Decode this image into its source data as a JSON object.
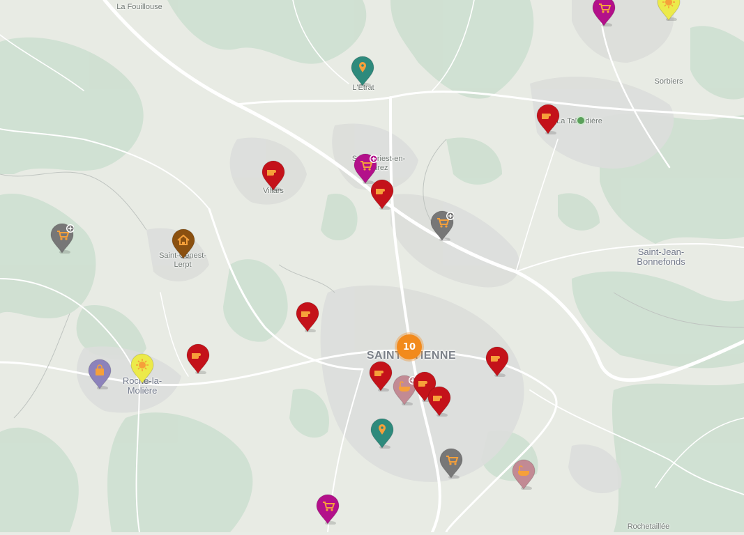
{
  "map": {
    "places": [
      {
        "id": "la-fouillouse",
        "label": "La Fouillouse"
      },
      {
        "id": "l-etrat",
        "label": "L'Etrat"
      },
      {
        "id": "sorbiers",
        "label": "Sorbiers"
      },
      {
        "id": "la-talaudiere",
        "label": "La Talaudière"
      },
      {
        "id": "saint-priest",
        "label": "Saint-Priest-en-Jarez"
      },
      {
        "id": "villars",
        "label": "Villars"
      },
      {
        "id": "saint-genest",
        "label": "Saint-Genest-Lerpt"
      },
      {
        "id": "saint-jean",
        "label": "Saint-Jean-Bonnefonds"
      },
      {
        "id": "saint-etienne",
        "label": "SAINT-ETIENNE"
      },
      {
        "id": "roche-la-moliere",
        "label": "Roche-la-Molière"
      },
      {
        "id": "rochetaillee",
        "label": "Rochetaillée"
      }
    ],
    "cluster": {
      "count": "10"
    },
    "markers": [
      {
        "type": "shop",
        "color": "#b3108a"
      },
      {
        "type": "sun",
        "color": "#ecea4a"
      },
      {
        "type": "pin",
        "color": "#2e8a7c"
      },
      {
        "type": "hand",
        "color": "#c4121a"
      },
      {
        "type": "shop-plus",
        "color": "#b3108a"
      },
      {
        "type": "hand",
        "color": "#c4121a"
      },
      {
        "type": "hand",
        "color": "#c4121a"
      },
      {
        "type": "shop-plus",
        "color": "#777777"
      },
      {
        "type": "shop-plus",
        "color": "#777777"
      },
      {
        "type": "home",
        "color": "#8a5010"
      },
      {
        "type": "hand",
        "color": "#c4121a"
      },
      {
        "type": "hand",
        "color": "#c4121a"
      },
      {
        "type": "bag",
        "color": "#8c82bb"
      },
      {
        "type": "sun",
        "color": "#ecea4a"
      },
      {
        "type": "hand",
        "color": "#c4121a"
      },
      {
        "type": "hand",
        "color": "#c4121a"
      },
      {
        "type": "bath-plus",
        "color": "#c28a94"
      },
      {
        "type": "hand",
        "color": "#c4121a"
      },
      {
        "type": "hand",
        "color": "#c4121a"
      },
      {
        "type": "pin",
        "color": "#2e8a7c"
      },
      {
        "type": "shop",
        "color": "#777777"
      },
      {
        "type": "bath",
        "color": "#c28a94"
      },
      {
        "type": "shop",
        "color": "#b3108a"
      }
    ]
  }
}
